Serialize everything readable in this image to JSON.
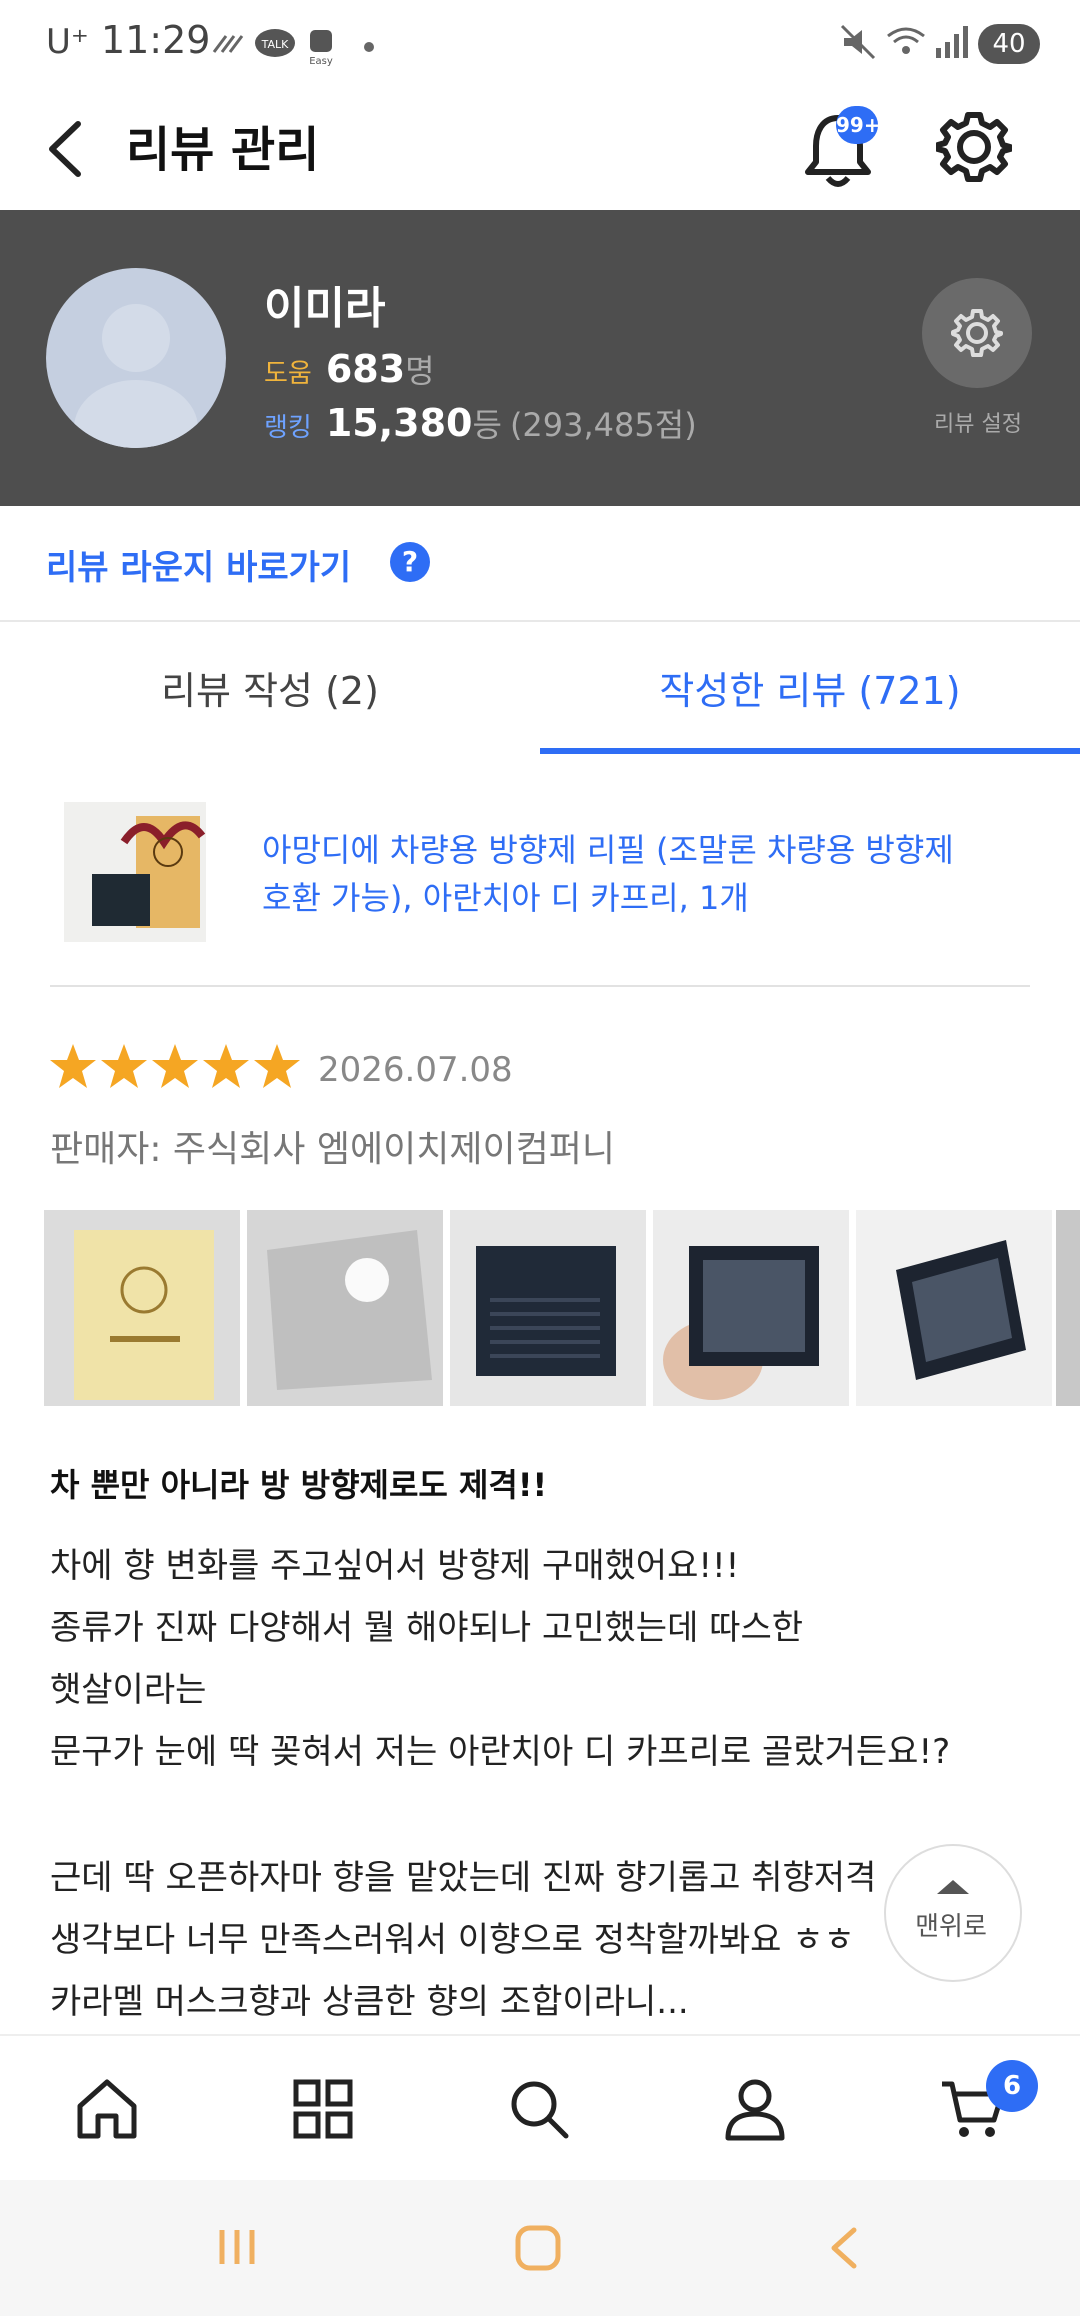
{
  "status_bar": {
    "carrier": "U⁺",
    "time": "11:29",
    "battery": "40"
  },
  "header": {
    "title": "리뷰 관리",
    "notification_badge": "99+"
  },
  "profile": {
    "name": "이미라",
    "help_label": "도움",
    "help_count": "683",
    "help_unit": "명",
    "rank_label": "랭킹",
    "rank_value": "15,380",
    "rank_unit": "등",
    "points": "(293,485점)",
    "settings_label": "리뷰 설정"
  },
  "lounge_link": {
    "label": "리뷰 라운지 바로가기",
    "help_icon": "?"
  },
  "tabs": [
    {
      "label": "리뷰 작성 (2)",
      "active": false
    },
    {
      "label": "작성한 리뷰 (721)",
      "active": true
    }
  ],
  "product": {
    "name_line1": "아망디에 차량용 방향제 리필 (조말론 차량용 방향제",
    "name_line2": "호환 가능), 아란치아 디 카프리, 1개"
  },
  "review": {
    "rating": 5,
    "date": "2026.07.08",
    "seller": "판매자: 주식회사 엠에이치제이컴퍼니",
    "title": "차 뿐만 아니라 방 방향제로도 제격!!",
    "lines": [
      "차에 향 변화를 주고싶어서 방향제 구매했어요!!!",
      "종류가 진짜 다양해서 뭘 해야되나 고민했는데 따스한",
      "햇살이라는",
      "문구가 눈에 딱 꽂혀서 저는 아란치아 디 카프리로 골랐거든요!?",
      "",
      "근데 딱 오픈하자마 향을 맡았는데 진짜 향기롭고 취향저격",
      "생각보다 너무 만족스러워서 이향으로 정착할까봐요 ㅎㅎ",
      "카라멜 머스크향과 상큼한 향의 조합이라니..."
    ]
  },
  "scroll_top_button": {
    "label": "맨위로"
  },
  "bottom_nav": {
    "cart_count": "6"
  },
  "colors": {
    "accent": "#2e6df5",
    "profile_bg": "#4e4e4e",
    "star": "#f5a623"
  }
}
